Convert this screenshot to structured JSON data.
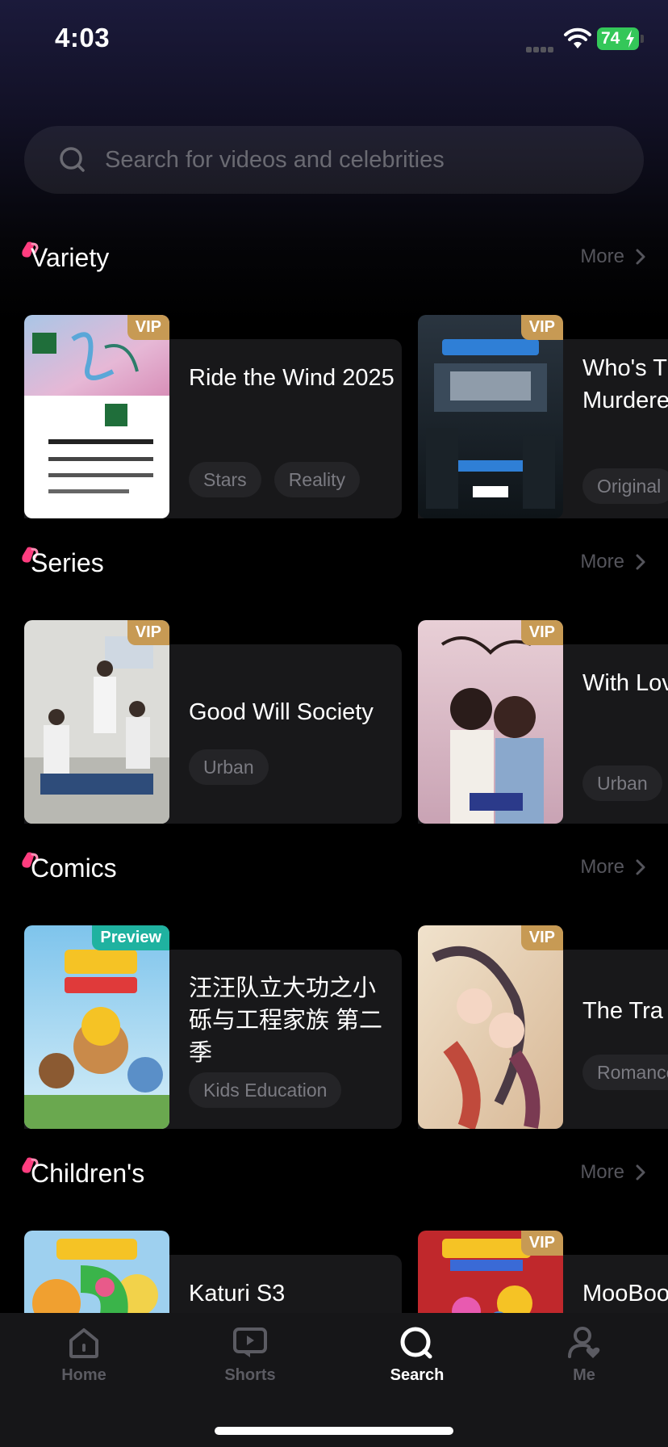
{
  "status_bar": {
    "time": "4:03",
    "battery": "74"
  },
  "search": {
    "placeholder": "Search for videos and celebrities"
  },
  "sections": [
    {
      "title": "Variety",
      "more": "More",
      "cards": [
        {
          "title": "Ride the Wind 2025",
          "badge": "VIP",
          "tags": [
            "Stars",
            "Reality"
          ]
        },
        {
          "title": "Who's The Murderer Season",
          "badge": "VIP",
          "tags": [
            "Original"
          ]
        }
      ]
    },
    {
      "title": "Series",
      "more": "More",
      "cards": [
        {
          "title": "Good Will Society",
          "badge": "VIP",
          "tags": [
            "Urban"
          ]
        },
        {
          "title": "With Love You",
          "badge": "VIP",
          "tags": [
            "Urban"
          ]
        }
      ]
    },
    {
      "title": "Comics",
      "more": "More",
      "cards": [
        {
          "title": "汪汪队立大功之小砾与工程家族 第二季",
          "badge": "Preview",
          "tags": [
            "Kids Education"
          ]
        },
        {
          "title": "The Tra",
          "badge": "VIP",
          "tags": [
            "Romance"
          ]
        }
      ]
    },
    {
      "title": "Children's",
      "more": "More",
      "cards": [
        {
          "title": "Katuri S3",
          "badge": "",
          "tags": []
        },
        {
          "title": "MooBoo Insect W",
          "badge": "VIP",
          "tags": []
        }
      ]
    }
  ],
  "tabbar": {
    "home": "Home",
    "shorts": "Shorts",
    "search": "Search",
    "me": "Me"
  },
  "colors": {
    "accent_pink": "#ff3d7f",
    "vip_gold": "#c79a54",
    "preview_teal": "#1fb2a0",
    "battery_green": "#34c759"
  }
}
